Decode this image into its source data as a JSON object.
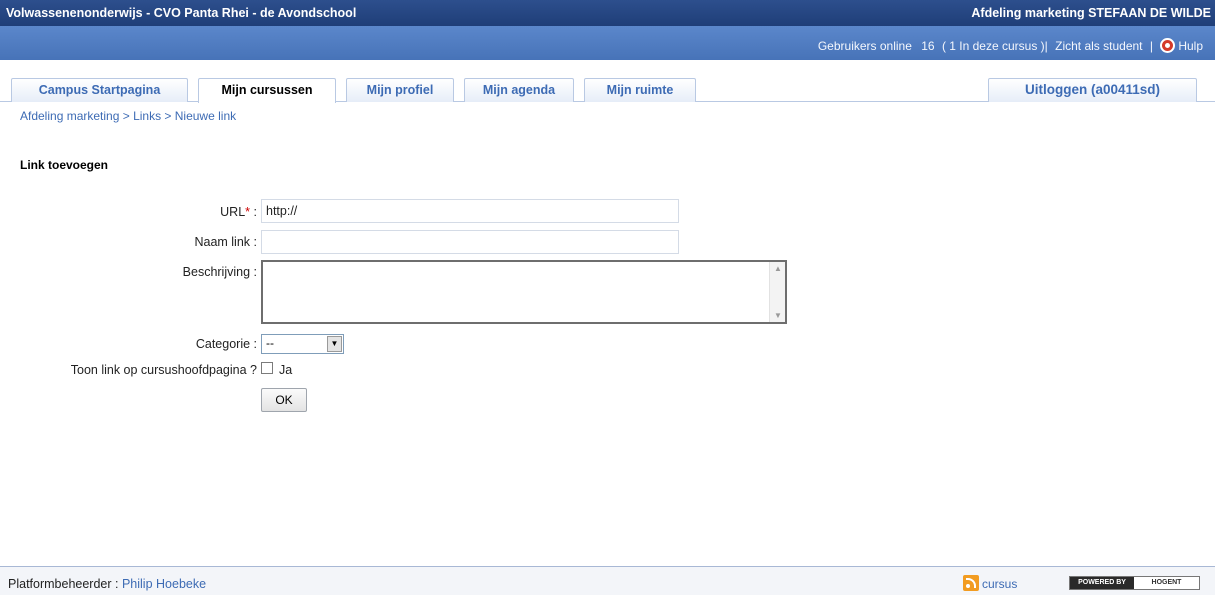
{
  "header": {
    "site_title": "Volwassenenonderwijs - CVO Panta Rhei - de Avondschool",
    "course_owner": "Afdeling marketing STEFAAN DE WILDE"
  },
  "subbar": {
    "users_online_label": "Gebruikers online",
    "users_online_count": "16",
    "in_course": "( 1 In deze cursus )|",
    "student_view": "Zicht als student",
    "sep": "|",
    "help": "Hulp"
  },
  "tabs": [
    {
      "label": "Campus Startpagina"
    },
    {
      "label": "Mijn cursussen"
    },
    {
      "label": "Mijn profiel"
    },
    {
      "label": "Mijn agenda"
    },
    {
      "label": "Mijn ruimte"
    }
  ],
  "logout": {
    "label": "Uitloggen (a00411sd)"
  },
  "breadcrumb": "Afdeling marketing > Links > Nieuwe link",
  "form": {
    "title": "Link toevoegen",
    "url_label": "URL",
    "url_required": "*",
    "url_colon": " :",
    "url_value": "http://",
    "name_label": "Naam link :",
    "name_value": "",
    "description_label": "Beschrijving :",
    "category_label": "Categorie :",
    "category_value": "--",
    "show_label": "Toon link op cursushoofdpagina ?",
    "show_option": "Ja",
    "submit": "OK"
  },
  "footer": {
    "admin_label": "Platformbeheerder :",
    "admin_name": "Philip Hoebeke",
    "rss_label": "cursus",
    "powered_by": "POWERED BY",
    "powered_brand": "HOGENT"
  },
  "colors": {
    "header": "#1f3e78",
    "subbar": "#4f7cc0",
    "link": "#3d6bb4"
  }
}
